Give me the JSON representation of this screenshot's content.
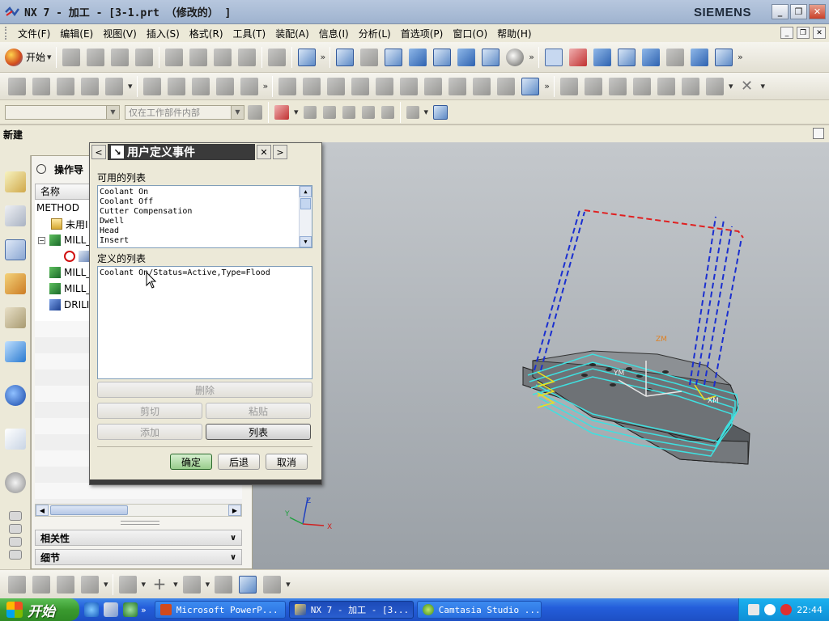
{
  "window": {
    "title": "NX 7 - 加工 - [3-1.prt （修改的） ]",
    "brand": "SIEMENS",
    "minimize_glyph": "_",
    "restore_glyph": "❐",
    "close_glyph": "✕"
  },
  "menubar": {
    "items": [
      "文件(F)",
      "编辑(E)",
      "视图(V)",
      "插入(S)",
      "格式(R)",
      "工具(T)",
      "装配(A)",
      "信息(I)",
      "分析(L)",
      "首选项(P)",
      "窗口(O)",
      "帮助(H)"
    ]
  },
  "toolbar": {
    "start_label": "开始",
    "filter_combo_placeholder": "",
    "selection_scope": "仅在工作部件内部"
  },
  "cue_line": "新建",
  "navigator": {
    "title": "操作导",
    "column_name": "名称",
    "rows": [
      {
        "label": "METHOD",
        "icon": "none"
      },
      {
        "label": "未用I",
        "icon": "folder-icon"
      },
      {
        "label": "MILL_",
        "icon": "mill-operation-icon"
      },
      {
        "label": "",
        "icon": "no-entry-icon"
      },
      {
        "label": "MILL_",
        "icon": "mill-operation-icon"
      },
      {
        "label": "MILL_",
        "icon": "mill-operation-icon"
      },
      {
        "label": "DRILI",
        "icon": "drill-operation-icon"
      }
    ],
    "dependencies_label": "相关性",
    "details_label": "细节"
  },
  "dialog": {
    "title": "用户定义事件",
    "available_list_label": "可用的列表",
    "available_items": [
      "Coolant On",
      "Coolant Off",
      "Cutter Compensation",
      "Dwell",
      "Head",
      "Insert"
    ],
    "defined_list_label": "定义的列表",
    "defined_items": [
      "Coolant On/Status=Active,Type=Flood"
    ],
    "buttons": {
      "delete": "删除",
      "cut": "剪切",
      "paste": "粘贴",
      "add": "添加",
      "list": "列表",
      "ok": "确定",
      "back": "后退",
      "cancel": "取消"
    }
  },
  "graphics": {
    "axis_labels": {
      "z": "Z",
      "y": "Y",
      "x": "X",
      "zm": "ZM",
      "ym": "YM",
      "xm": "XM"
    }
  },
  "taskbar": {
    "start_label": "开始",
    "tasks": [
      "Microsoft PowerP...",
      "NX 7 - 加工 - [3...",
      "Camtasia Studio ..."
    ],
    "clock": "22:44"
  },
  "colors": {
    "toolpath_cyan": "#3fe0e0",
    "rapid_blue": "#1a2fd0",
    "rapid_red": "#e02020",
    "dialog_title_bg": "#3a3a3a",
    "ok_button_green": "#98cc8c"
  }
}
